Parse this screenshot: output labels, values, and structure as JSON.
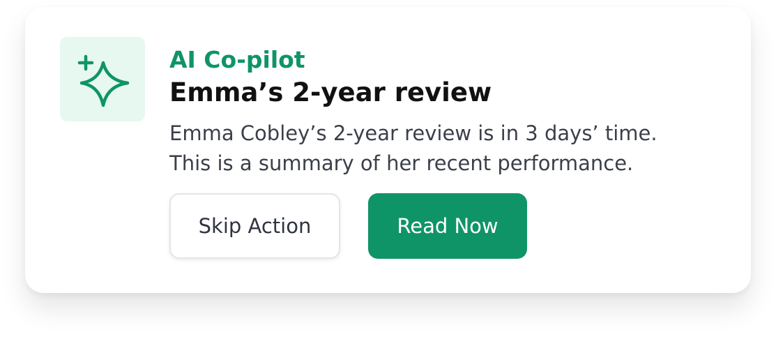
{
  "card": {
    "eyebrow": "AI Co-pilot",
    "title": "Emma’s 2-year review",
    "description_lines": [
      "Emma Cobley’s 2-year review is in 3 days’ time.",
      "This is a summary of her recent performance."
    ],
    "icon": "sparkle-icon",
    "actions": {
      "skip_label": "Skip Action",
      "read_label": "Read Now"
    }
  },
  "colors": {
    "accent": "#0f9467",
    "icon_tile_bg": "#e6f8ef",
    "title_text": "#111111",
    "body_text": "#3b3f4a"
  }
}
